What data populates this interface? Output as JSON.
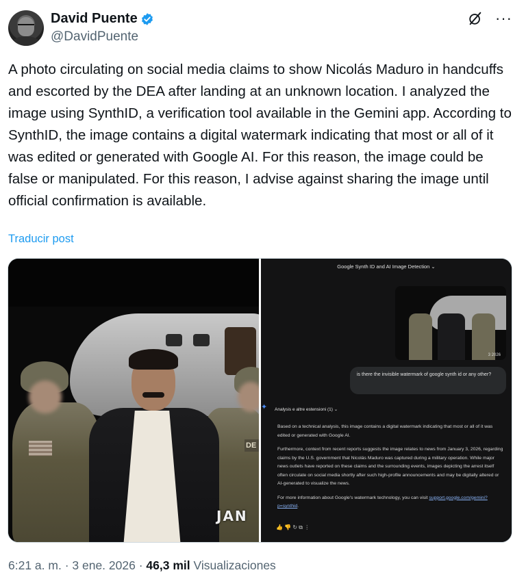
{
  "author": {
    "display_name": "David Puente",
    "handle": "@DavidPuente",
    "verified_icon": "verified-badge-icon",
    "verified_color": "#1d9bf0"
  },
  "actions": {
    "grok_icon": "grok-icon",
    "more_label": "···"
  },
  "post": {
    "text": "A photo circulating on social media claims to show Nicolás Maduro in handcuffs and escorted by the DEA after landing at an unknown location. I analyzed the image using SynthID, a verification tool available in the Gemini app. According to SynthID, the image contains a digital watermark indicating that most or all of it was edited or generated with Google AI. For this reason, the image could be false or manipulated. For this reason, I advise against sharing the image until official confirmation is available.",
    "translate_label": "Traducir post"
  },
  "media": {
    "left_photo": {
      "overlay_text": "JAN",
      "patch_text": "DE"
    },
    "right_screenshot": {
      "title": "Google Synth ID and AI Image Detection ⌄",
      "thumb_date": "3 2026",
      "user_prompt": "is there the invisible watermark of google synth id or any other?",
      "tools_label": "Analysis e altre estensioni (1)  ⌄",
      "response_p1": "Based on a technical analysis, this image contains a digital watermark indicating that most or all of it was edited or generated with Google AI.",
      "response_p2": "Furthermore, context from recent reports suggests the image relates to news from January 3, 2026, regarding claims by the U.S. government that Nicolás Maduro was captured during a military operation. While major news outlets have reported on these claims and the surrounding events, images depicting the arrest itself often circulate on social media shortly after such high-profile announcements and may be digitally altered or AI-generated to visualize the news.",
      "response_p3_prefix": "For more information about Google's watermark technology, you can visit",
      "response_link": "support.google.com/gemini?p=synthid",
      "action_icons": "👍  👎  ↻  ⧉  ⋮"
    }
  },
  "meta": {
    "time": "6:21 a. m.",
    "separator": " · ",
    "date": "3 ene. 2026",
    "views_count": "46,3 mil",
    "views_label": "Visualizaciones"
  }
}
